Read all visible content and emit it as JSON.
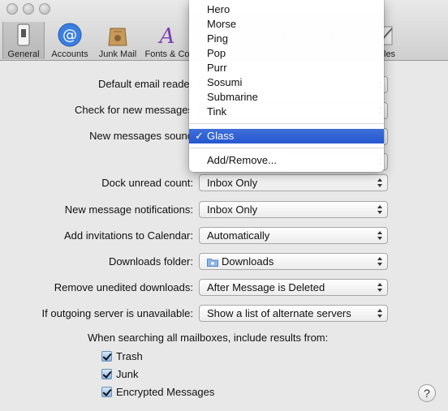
{
  "toolbar": {
    "items": [
      {
        "label": "General"
      },
      {
        "label": "Accounts"
      },
      {
        "label": "Junk Mail"
      },
      {
        "label": "Fonts & Co"
      },
      {
        "label": "les"
      }
    ]
  },
  "settings": {
    "default_email_reader_label": "Default email reader",
    "check_new_messages_label": "Check for new messages",
    "new_messages_sound_label": "New messages sound",
    "dock_unread_label": "Dock unread count:",
    "dock_unread_value": "Inbox Only",
    "new_message_notifications_label": "New message notifications:",
    "new_message_notifications_value": "Inbox Only",
    "add_invitations_label": "Add invitations to Calendar:",
    "add_invitations_value": "Automatically",
    "downloads_folder_label": "Downloads folder:",
    "downloads_folder_value": "Downloads",
    "remove_unedited_label": "Remove unedited downloads:",
    "remove_unedited_value": "After Message is Deleted",
    "outgoing_server_label": "If outgoing server is unavailable:",
    "outgoing_server_value": "Show a list of alternate servers",
    "search_heading": "When searching all mailboxes, include results from:",
    "checkboxes": [
      {
        "label": "Trash",
        "checked": true
      },
      {
        "label": "Junk",
        "checked": true
      },
      {
        "label": "Encrypted Messages",
        "checked": true
      }
    ]
  },
  "sound_menu": {
    "items": [
      "Hero",
      "Morse",
      "Ping",
      "Pop",
      "Purr",
      "Sosumi",
      "Submarine",
      "Tink"
    ],
    "selected": "Glass",
    "checkmark": "✓",
    "add_remove": "Add/Remove..."
  },
  "help": {
    "label": "?"
  }
}
